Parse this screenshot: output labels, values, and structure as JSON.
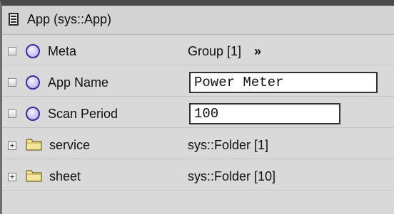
{
  "header": {
    "title": "App  (sys::App)",
    "icon": "document-list-icon"
  },
  "rows": [
    {
      "name": "Meta",
      "value": "Group [1]",
      "chevron": "»"
    },
    {
      "name": "App Name",
      "value": "Power Meter"
    },
    {
      "name": "Scan Period",
      "value": "100"
    },
    {
      "name": "service",
      "value": "sys::Folder [1]",
      "expand": "+"
    },
    {
      "name": "sheet",
      "value": "sys::Folder [10]",
      "expand": "+"
    }
  ],
  "colors": {
    "radio_border": "#34309e",
    "folder_fill": "#f2e69a",
    "frame": "#4a4a4a"
  }
}
